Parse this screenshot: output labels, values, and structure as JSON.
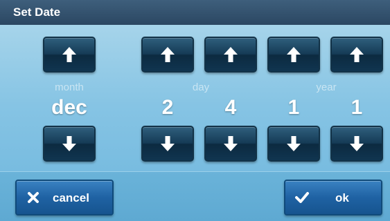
{
  "title": "Set Date",
  "columns": {
    "month": {
      "label": "month",
      "value": "dec"
    },
    "day": {
      "label": "day",
      "digits": [
        "2",
        "4"
      ]
    },
    "year": {
      "label": "year",
      "digits": [
        "1",
        "1"
      ]
    }
  },
  "actions": {
    "cancel_label": "cancel",
    "ok_label": "ok"
  },
  "icons": {
    "up": "arrow-up-icon",
    "down": "arrow-down-icon",
    "cancel": "x-icon",
    "ok": "checkmark-icon"
  },
  "colors": {
    "title_bar": "#2f4f6d",
    "button": "#153b56",
    "action_button": "#1f62a3",
    "label": "#c9e5f3"
  }
}
